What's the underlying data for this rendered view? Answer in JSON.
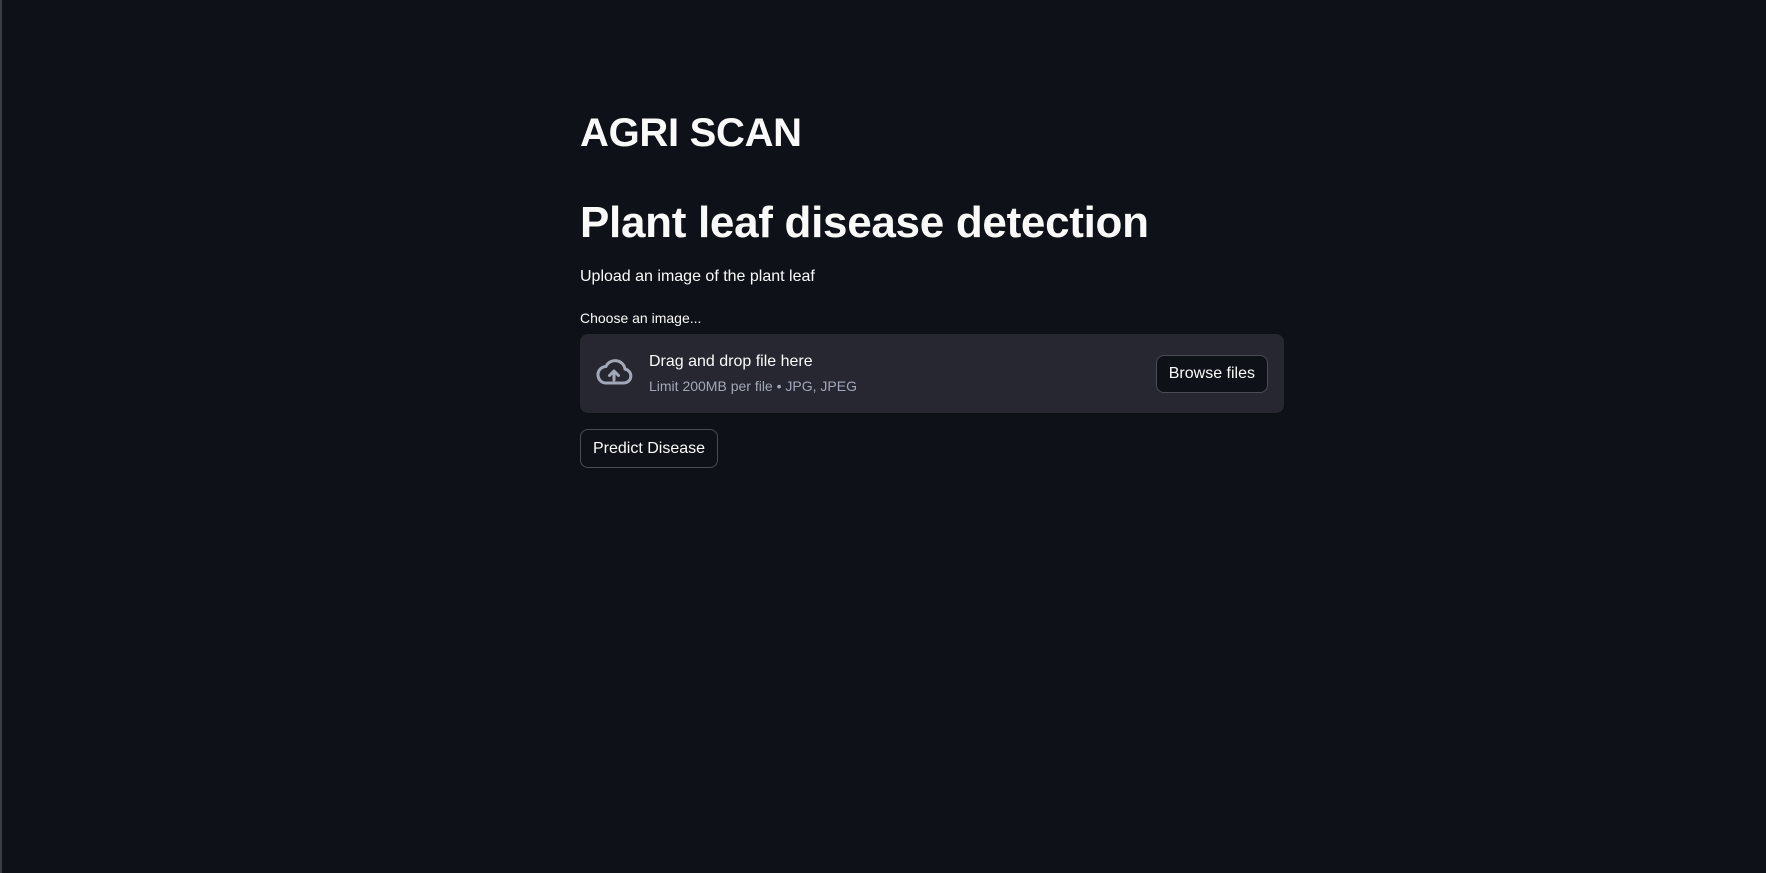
{
  "app": {
    "title": "AGRI SCAN"
  },
  "page": {
    "heading": "Plant leaf disease detection",
    "subtitle": "Upload an image of the plant leaf"
  },
  "uploader": {
    "label": "Choose an image...",
    "dropzone_text": "Drag and drop file here",
    "limit_text": "Limit 200MB per file • JPG, JPEG",
    "browse_label": "Browse files",
    "icon": "cloud-upload-icon"
  },
  "actions": {
    "predict_label": "Predict Disease"
  },
  "colors": {
    "background": "#0e1117",
    "dropzone": "#262730",
    "text": "#fafafa",
    "muted": "#a3a8b8",
    "border": "#4a4c55"
  }
}
